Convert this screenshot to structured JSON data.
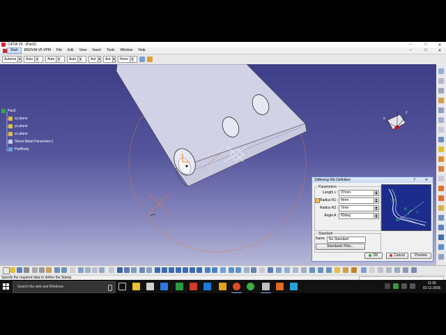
{
  "window": {
    "title": "CATIA V5 - [Part2]",
    "controls": [
      "–",
      "□",
      "✕"
    ],
    "child_controls": [
      "–",
      "□",
      "✕"
    ]
  },
  "menu": {
    "items": [
      "Start",
      "ENOVIA V5 VPM",
      "File",
      "Edit",
      "View",
      "Insert",
      "Tools",
      "Window",
      "Help"
    ]
  },
  "toolbar": {
    "combos": [
      "Automa",
      "Auto",
      "Auto",
      "Auto",
      "Aut",
      "Aut",
      "None"
    ]
  },
  "tree": {
    "root": "Part2",
    "items": [
      "xy plane",
      "yz plane",
      "zx plane",
      "Sheet Metal Parameter.1",
      "PartBody"
    ]
  },
  "compass": {
    "x_label": "x",
    "y_label": "y"
  },
  "dialog": {
    "title": "Stiffening Rib Definition",
    "help": "?",
    "close": "✕",
    "parameters_group": "Parameters",
    "params": [
      {
        "label": "Length L :",
        "value": "37mm",
        "has_check": false
      },
      {
        "label": "Radius R1 :",
        "value": "4mm",
        "has_check": true
      },
      {
        "label": "Radius R2 :",
        "value": "7mm",
        "has_check": false
      },
      {
        "label": "Angle A :",
        "value": "83deg",
        "has_check": false
      }
    ],
    "preview_labels": {
      "r1": "R1",
      "a": "A",
      "l": "L",
      "r2": "R2"
    },
    "standard_group": "Standard",
    "name_label": "Name :",
    "name_value": "No Standard",
    "standard_files_button": "Standards Files...",
    "ok": "OK",
    "cancel": "Cancel",
    "preview_button": "Preview"
  },
  "status": {
    "message": "Specify the required data to define the Stamp"
  },
  "taskbar": {
    "search_placeholder": "Search the web and Windows",
    "time": "11:33",
    "date": "01-11-2016"
  },
  "colors": {
    "viewport_top": "#3e3e88",
    "viewport_bottom": "#b8b8d8",
    "part_face": "#dcdcec",
    "highlight_orange": "#e07a2a",
    "selection_blue": "#1c2c8c"
  }
}
